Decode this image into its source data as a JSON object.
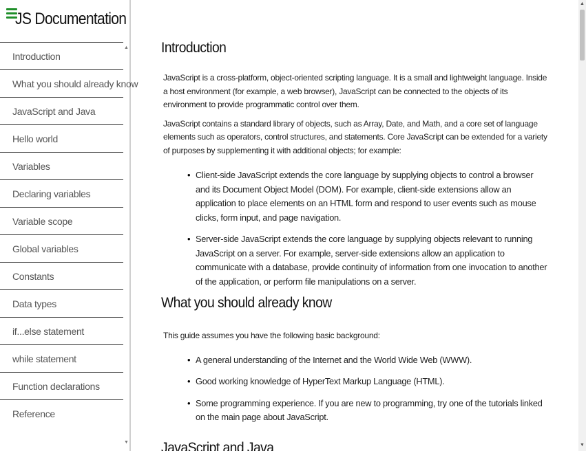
{
  "sidebar": {
    "title": "JS Documentation",
    "items": [
      {
        "label": "Introduction"
      },
      {
        "label": "What you should already know"
      },
      {
        "label": "JavaScript and Java"
      },
      {
        "label": "Hello world"
      },
      {
        "label": "Variables"
      },
      {
        "label": "Declaring variables"
      },
      {
        "label": "Variable scope"
      },
      {
        "label": "Global variables"
      },
      {
        "label": "Constants"
      },
      {
        "label": "Data types"
      },
      {
        "label": "if...else statement"
      },
      {
        "label": "while statement"
      },
      {
        "label": "Function declarations"
      },
      {
        "label": "Reference"
      }
    ]
  },
  "main": {
    "sections": [
      {
        "title": "Introduction",
        "paragraphs": [
          "JavaScript is a cross-platform, object-oriented scripting language. It is a small and lightweight language. Inside a host environment (for example, a web browser), JavaScript can be connected to the objects of its environment to provide programmatic control over them.",
          "JavaScript contains a standard library of objects, such as Array, Date, and Math, and a core set of language elements such as operators, control structures, and statements. Core JavaScript can be extended for a variety of purposes by supplementing it with additional objects; for example:"
        ],
        "bullets": [
          "Client-side JavaScript extends the core language by supplying objects to control a browser and its Document Object Model (DOM). For example, client-side extensions allow an application to place elements on an HTML form and respond to user events such as mouse clicks, form input, and page navigation.",
          "Server-side JavaScript extends the core language by supplying objects relevant to running JavaScript on a server. For example, server-side extensions allow an application to communicate with a database, provide continuity of information from one invocation to another of the application, or perform file manipulations on a server."
        ]
      },
      {
        "title": "What you should already know",
        "paragraphs": [
          "This guide assumes you have the following basic background:"
        ],
        "bullets": [
          "A general understanding of the Internet and the World Wide Web (WWW).",
          "Good working knowledge of HyperText Markup Language (HTML).",
          "Some programming experience. If you are new to programming, try one of the tutorials linked on the main page about JavaScript."
        ]
      },
      {
        "title": "JavaScript and Java"
      }
    ]
  },
  "colors": {
    "accent": "#1f8f2a",
    "divider": "#333333",
    "sidebar_border": "#cfcfcf",
    "scroll_thumb": "#c1c1c1"
  },
  "icons": {
    "menu": "hamburger-icon"
  }
}
